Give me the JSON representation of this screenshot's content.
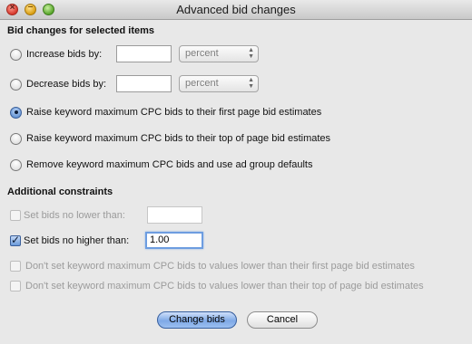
{
  "window": {
    "title": "Advanced bid changes",
    "controls": {
      "close": "×",
      "minimize": "–",
      "zoom": "+"
    }
  },
  "bid_changes": {
    "header": "Bid changes for selected items",
    "options": [
      {
        "label": "Increase bids by:",
        "selected": false
      },
      {
        "label": "Decrease bids by:",
        "selected": false
      },
      {
        "label": "Raise keyword maximum CPC bids to their first page bid estimates",
        "selected": true
      },
      {
        "label": "Raise keyword maximum CPC bids to their top of page bid estimates",
        "selected": false
      },
      {
        "label": "Remove keyword maximum CPC bids and use ad group defaults",
        "selected": false
      }
    ],
    "increase_amount": "",
    "increase_unit": "percent",
    "decrease_amount": "",
    "decrease_unit": "percent"
  },
  "constraints": {
    "header": "Additional constraints",
    "no_lower_label": "Set bids no lower than:",
    "no_lower_value": "",
    "no_higher_label": "Set bids no higher than:",
    "no_higher_value": "1.00",
    "first_page_label": "Don't set keyword maximum CPC bids to values lower than their first page bid estimates",
    "top_page_label": "Don't set keyword maximum CPC bids to values lower than their top of page bid estimates"
  },
  "buttons": {
    "change_bids": "Change bids",
    "cancel": "Cancel"
  }
}
